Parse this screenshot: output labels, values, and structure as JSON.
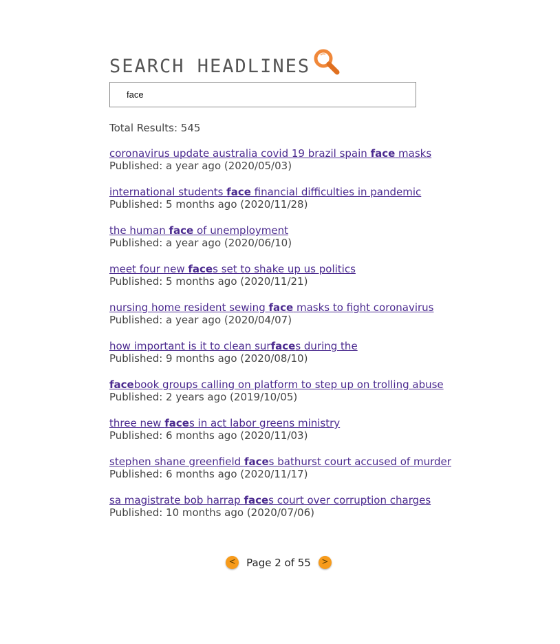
{
  "header": {
    "title": "SEARCH HEADLINES",
    "icon": "magnifier-icon",
    "icon_color": "#f0883a"
  },
  "search": {
    "value": "face",
    "placeholder": ""
  },
  "summary": {
    "total_label": "Total Results: 545"
  },
  "query_highlight": "face",
  "results": [
    {
      "headline_parts": [
        "coronavirus update australia covid 19 brazil spain ",
        "face",
        " masks"
      ],
      "published": "Published: a year ago (2020/05/03)"
    },
    {
      "headline_parts": [
        "international students ",
        "face",
        " financial difficulties in pandemic"
      ],
      "published": "Published: 5 months ago (2020/11/28)"
    },
    {
      "headline_parts": [
        "the human ",
        "face",
        " of unemployment"
      ],
      "published": "Published: a year ago (2020/06/10)"
    },
    {
      "headline_parts": [
        "meet four new ",
        "face",
        "s set to shake up us politics"
      ],
      "published": "Published: 5 months ago (2020/11/21)"
    },
    {
      "headline_parts": [
        "nursing home resident sewing ",
        "face",
        " masks to fight coronavirus"
      ],
      "published": "Published: a year ago (2020/04/07)"
    },
    {
      "headline_parts": [
        "how important is it to clean sur",
        "face",
        "s during the"
      ],
      "published": "Published: 9 months ago (2020/08/10)"
    },
    {
      "headline_parts": [
        "",
        "face",
        "book groups calling on platform to step up on trolling abuse"
      ],
      "published": "Published: 2 years ago (2019/10/05)"
    },
    {
      "headline_parts": [
        "three new ",
        "face",
        "s in act labor greens ministry"
      ],
      "published": "Published: 6 months ago (2020/11/03)"
    },
    {
      "headline_parts": [
        "stephen shane greenfield ",
        "face",
        "s bathurst court accused of murder"
      ],
      "published": "Published: 6 months ago (2020/11/17)"
    },
    {
      "headline_parts": [
        "sa magistrate bob harrap ",
        "face",
        "s court over corruption charges"
      ],
      "published": "Published: 10 months ago (2020/07/06)"
    }
  ],
  "pagination": {
    "prev_label": "<",
    "next_label": ">",
    "page_label": "Page 2 of 55",
    "current_page": 2,
    "total_pages": 55,
    "button_color": "#f79b1b"
  },
  "colors": {
    "link": "#4b2a8f",
    "text": "#444444",
    "title": "#555555"
  }
}
